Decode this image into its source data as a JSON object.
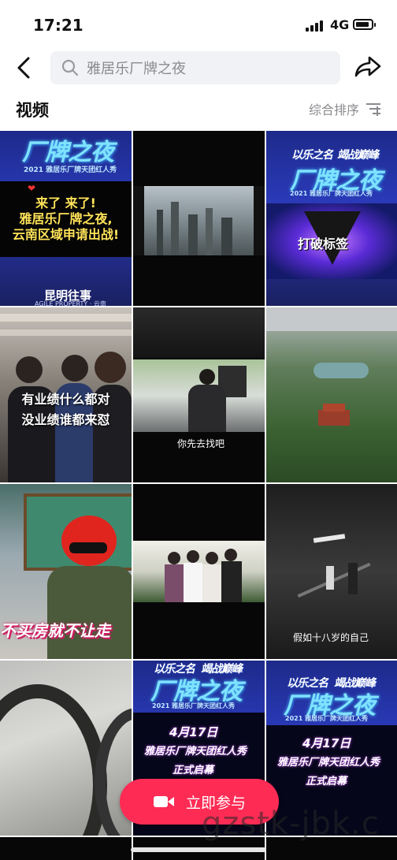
{
  "status_bar": {
    "time": "17:21",
    "network": "4G"
  },
  "search": {
    "query": "雅居乐厂牌之夜"
  },
  "section": {
    "title": "视频",
    "sort_label": "综合排序"
  },
  "videos": [
    {
      "caption_lines": [
        "来了 来了!",
        "雅居乐厂牌之夜,",
        "云南区域申请出战!"
      ],
      "banner": "厂牌之夜",
      "sub": "2021 雅居乐厂牌天团红人秀",
      "brand": "昆明往事",
      "brand_en": "AGILE PROPERTY · 云南"
    },
    {
      "kind": "city-film"
    },
    {
      "banner_top": "以乐之名",
      "banner_top2": "竭战巅峰",
      "banner": "厂牌之夜",
      "sub": "2021 雅居乐厂牌天团红人秀",
      "caption": "打破标签"
    },
    {
      "caption_lines": [
        "有业绩什么都对",
        "没业绩谁都来怼"
      ]
    },
    {
      "caption": "你先去找吧"
    },
    {
      "kind": "aerial-park"
    },
    {
      "caption": "不买房就不让走"
    },
    {
      "kind": "office-group"
    },
    {
      "caption": "假如十八岁的自己"
    },
    {
      "kind": "road-aerial"
    },
    {
      "banner_top": "以乐之名",
      "banner_top2": "竭战巅峰",
      "banner": "厂牌之夜",
      "sub": "2021 雅居乐厂牌天团红人秀",
      "date_line": "4月17日",
      "line2": "雅居乐厂牌天团红人秀",
      "line3": "正式启幕"
    },
    {
      "banner_top": "以乐之名",
      "banner_top2": "竭战巅峰",
      "banner": "厂牌之夜",
      "sub": "2021 雅居乐厂牌天团红人秀",
      "date_line": "4月17日",
      "line2": "雅居乐厂牌天团红人秀",
      "line3": "正式启幕"
    }
  ],
  "cta": {
    "label": "立即参与"
  },
  "watermark": "gzstk-jbk.c",
  "colors": {
    "accent": "#fe2c55",
    "search_bg": "#f1f2f5"
  }
}
